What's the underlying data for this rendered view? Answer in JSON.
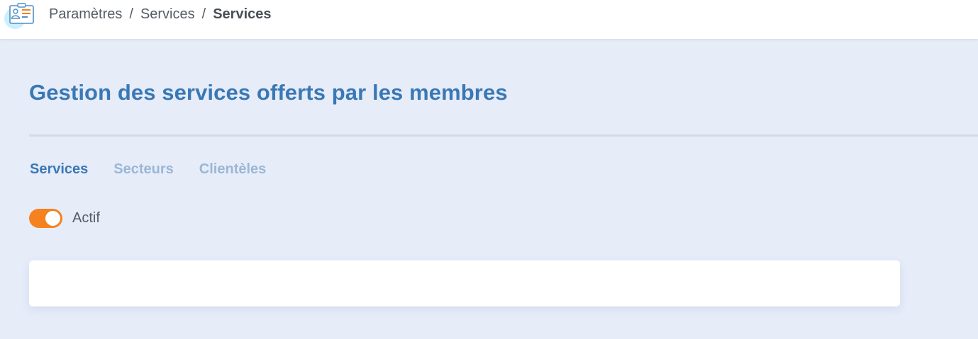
{
  "breadcrumb": {
    "items": [
      "Paramètres",
      "Services"
    ],
    "separator": "/",
    "current": "Services"
  },
  "page": {
    "title": "Gestion des services offerts par les membres"
  },
  "tabs": [
    {
      "label": "Services",
      "active": true
    },
    {
      "label": "Secteurs",
      "active": false
    },
    {
      "label": "Clientèles",
      "active": false
    }
  ],
  "toggle": {
    "label": "Actif",
    "on": true
  },
  "colors": {
    "accent": "#3a78b5",
    "toggle_on": "#f5821f",
    "background": "#e6ecf8",
    "tab_inactive": "#9bb7d6"
  },
  "icons": {
    "app": "id-card-icon"
  }
}
